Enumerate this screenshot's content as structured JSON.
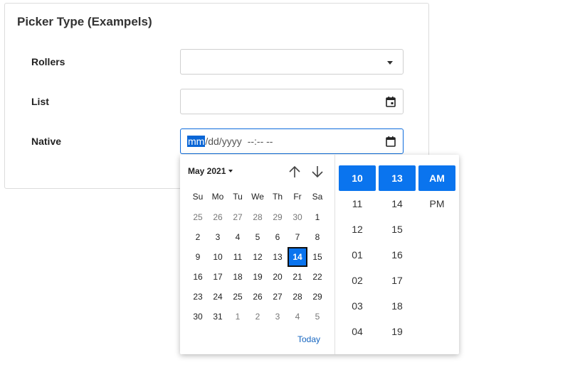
{
  "card": {
    "title": "Picker Type (Exampels)"
  },
  "rows": {
    "rollers_label": "Rollers",
    "list_label": "List",
    "native_label": "Native"
  },
  "native_input": {
    "mm": "mm",
    "dd": "dd",
    "yyyy": "yyyy",
    "time": "--:-- --"
  },
  "calendar": {
    "month_label": "May 2021",
    "weekdays": [
      "Su",
      "Mo",
      "Tu",
      "We",
      "Th",
      "Fr",
      "Sa"
    ],
    "weeks": [
      [
        {
          "d": "25",
          "other": true
        },
        {
          "d": "26",
          "other": true
        },
        {
          "d": "27",
          "other": true
        },
        {
          "d": "28",
          "other": true
        },
        {
          "d": "29",
          "other": true
        },
        {
          "d": "30",
          "other": true
        },
        {
          "d": "1"
        }
      ],
      [
        {
          "d": "2"
        },
        {
          "d": "3"
        },
        {
          "d": "4"
        },
        {
          "d": "5"
        },
        {
          "d": "6"
        },
        {
          "d": "7"
        },
        {
          "d": "8"
        }
      ],
      [
        {
          "d": "9"
        },
        {
          "d": "10"
        },
        {
          "d": "11"
        },
        {
          "d": "12"
        },
        {
          "d": "13"
        },
        {
          "d": "14",
          "selected": true
        },
        {
          "d": "15"
        }
      ],
      [
        {
          "d": "16"
        },
        {
          "d": "17"
        },
        {
          "d": "18"
        },
        {
          "d": "19"
        },
        {
          "d": "20"
        },
        {
          "d": "21"
        },
        {
          "d": "22"
        }
      ],
      [
        {
          "d": "23"
        },
        {
          "d": "24"
        },
        {
          "d": "25"
        },
        {
          "d": "26"
        },
        {
          "d": "27"
        },
        {
          "d": "28"
        },
        {
          "d": "29"
        }
      ],
      [
        {
          "d": "30"
        },
        {
          "d": "31"
        },
        {
          "d": "1",
          "other": true
        },
        {
          "d": "2",
          "other": true
        },
        {
          "d": "3",
          "other": true
        },
        {
          "d": "4",
          "other": true
        },
        {
          "d": "5",
          "other": true
        }
      ]
    ],
    "today_label": "Today"
  },
  "time": {
    "hours": [
      "10",
      "11",
      "12",
      "01",
      "02",
      "03",
      "04"
    ],
    "minutes": [
      "13",
      "14",
      "15",
      "16",
      "17",
      "18",
      "19"
    ],
    "ampm": [
      "AM",
      "PM"
    ],
    "selected": {
      "hour": "10",
      "minute": "13",
      "ampm": "AM"
    }
  },
  "icons": {
    "rollers": "chevron-down-icon",
    "list": "calendar-icon",
    "native": "calendar-icon",
    "nav_up": "arrow-up-icon",
    "nav_down": "arrow-down-icon"
  },
  "colors": {
    "accent": "#0a74ee",
    "focus_border": "#0d6bdc",
    "link": "#1565c0"
  }
}
